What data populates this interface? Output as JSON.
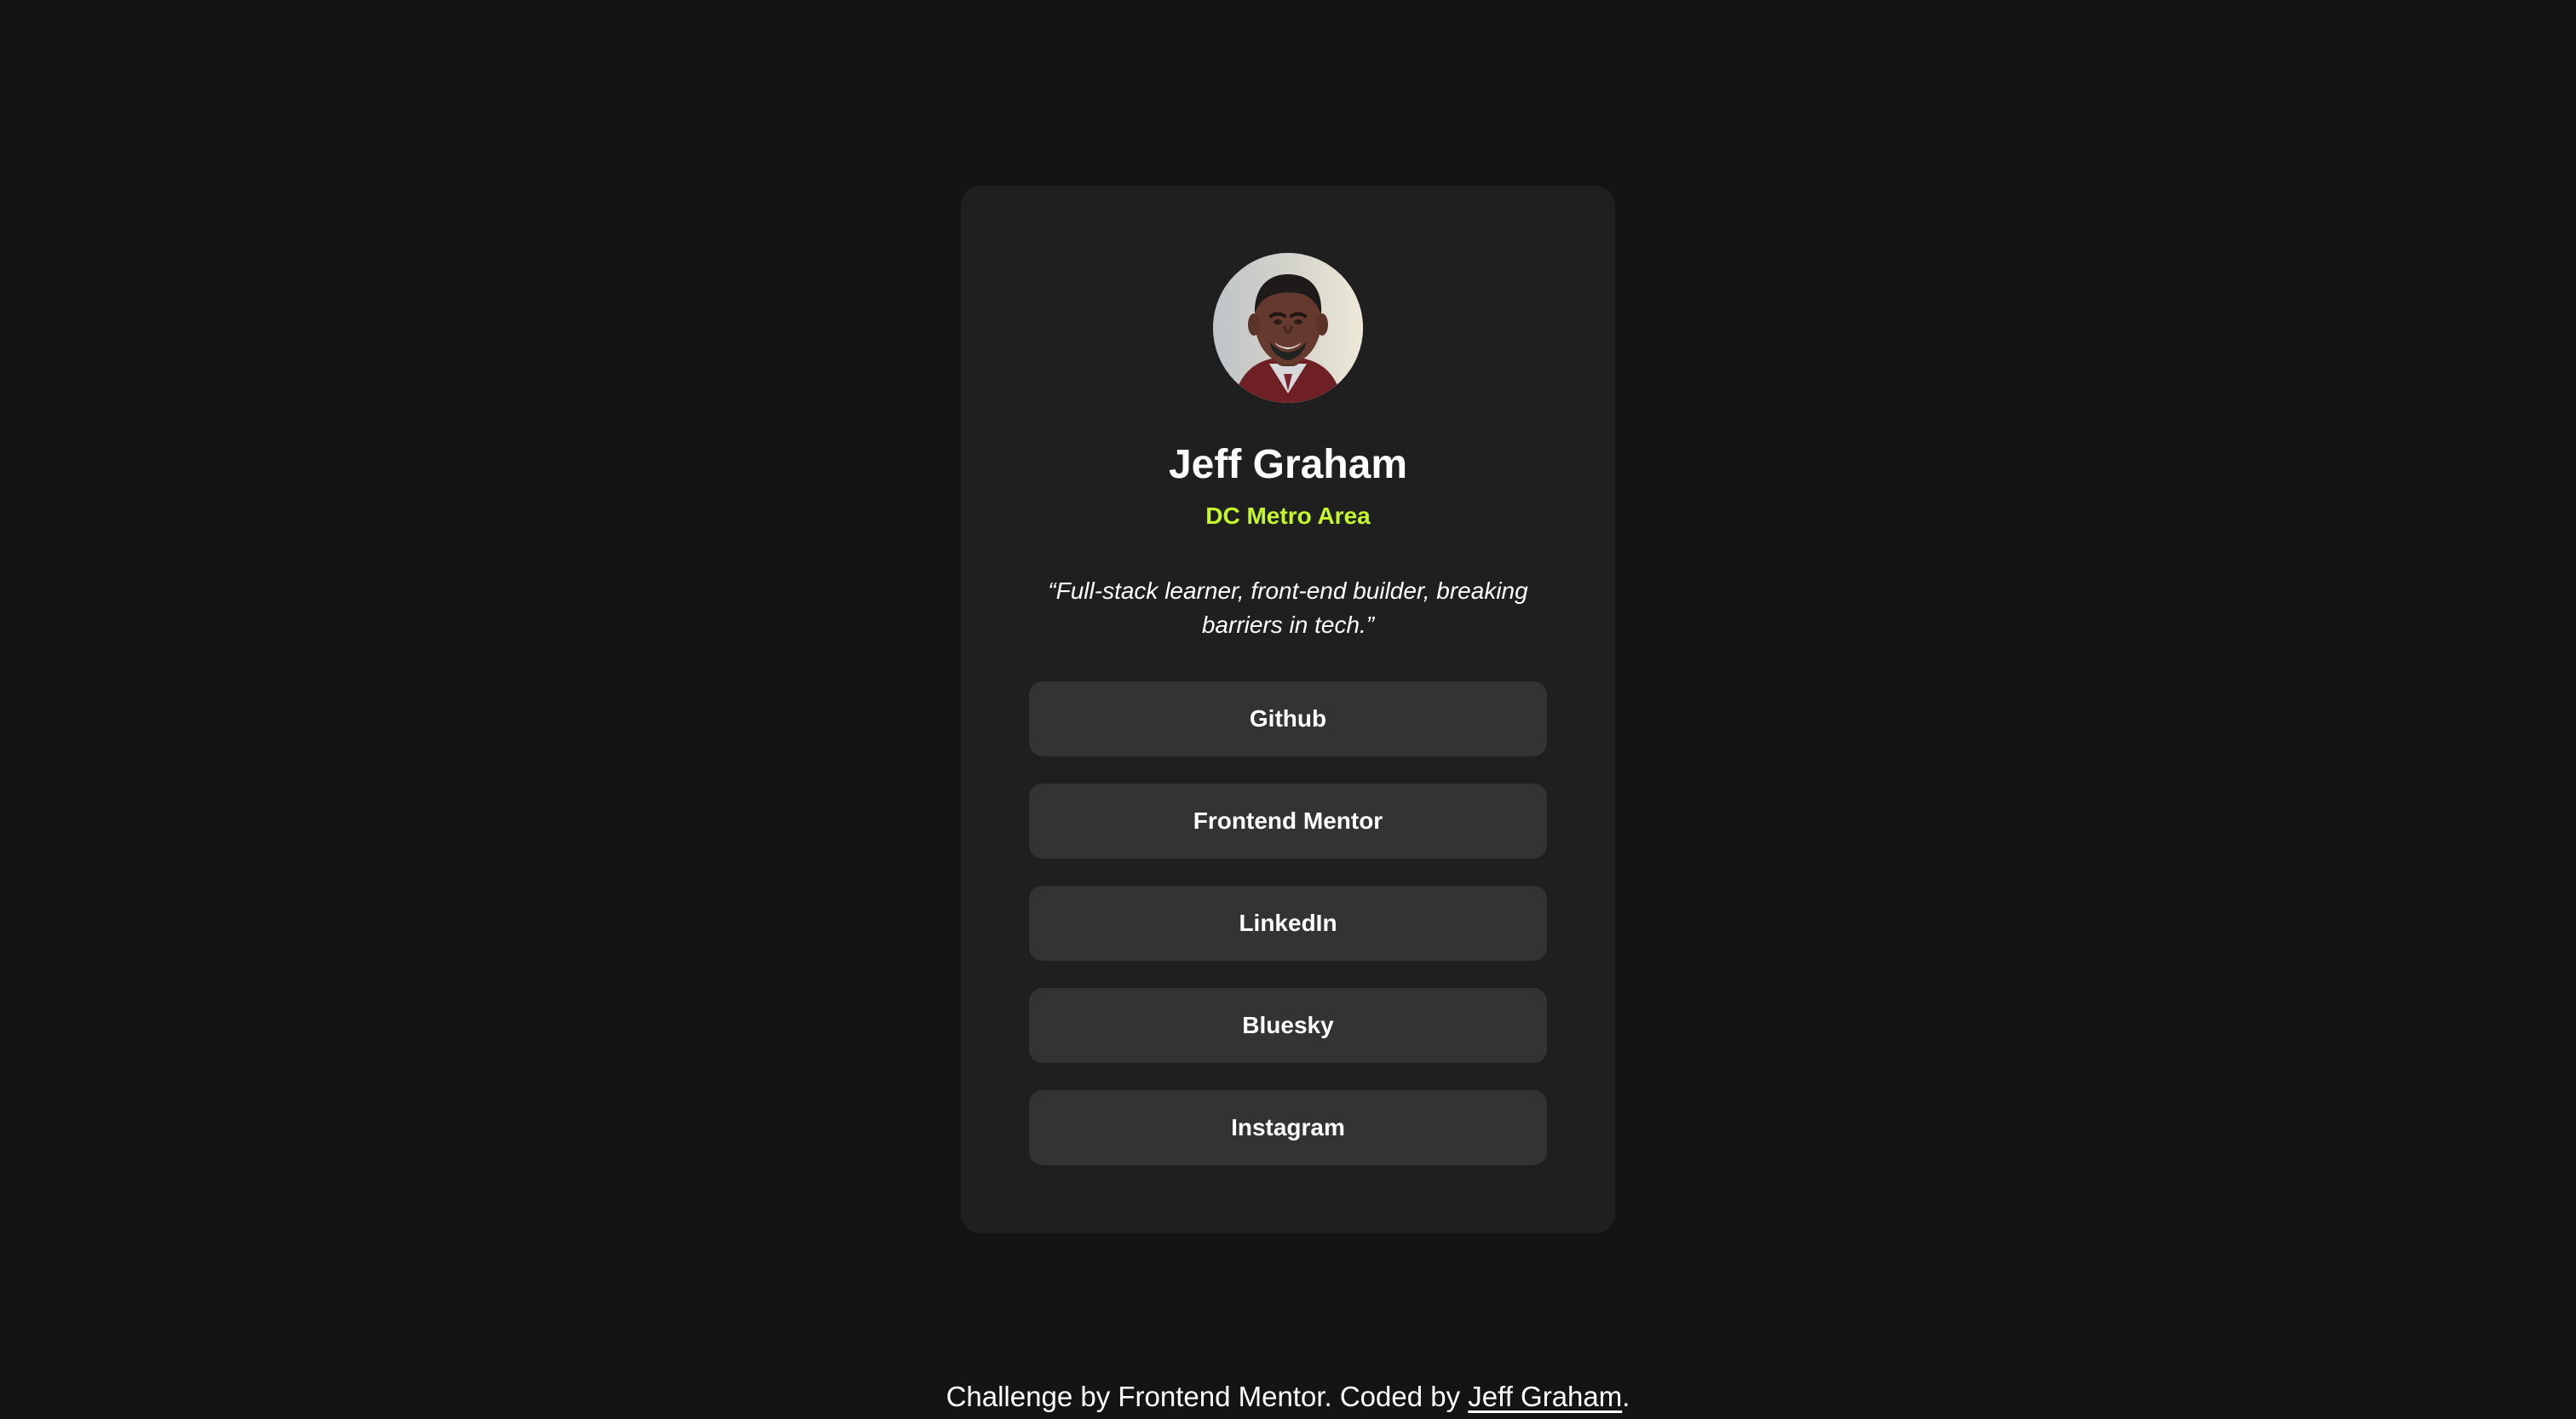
{
  "profile": {
    "name": "Jeff Graham",
    "location": "DC Metro Area",
    "bio": "“Full-stack learner, front-end builder, breaking barriers in tech.”",
    "avatar_icon": "profile-photo"
  },
  "links": [
    {
      "label": "Github"
    },
    {
      "label": "Frontend Mentor"
    },
    {
      "label": "LinkedIn"
    },
    {
      "label": "Bluesky"
    },
    {
      "label": "Instagram"
    }
  ],
  "footer": {
    "prefix": "Challenge by Frontend Mentor. Coded by ",
    "author_link": "Jeff Graham",
    "suffix": "."
  },
  "colors": {
    "background": "#141414",
    "card": "#1f1f1f",
    "button": "#333333",
    "accent": "#c4f82a",
    "text": "#ffffff"
  }
}
